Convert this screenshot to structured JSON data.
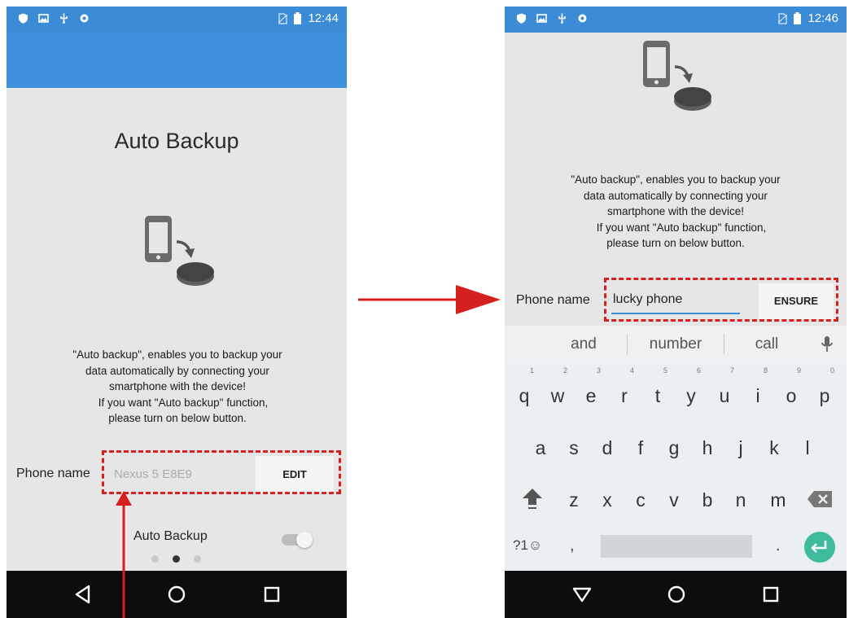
{
  "left": {
    "status": {
      "time": "12:44"
    },
    "title": "Auto Backup",
    "description": [
      "\"Auto backup\", enables you to backup your",
      "data automatically by connecting your",
      "smartphone with the device!",
      "If you want \"Auto backup\" function,",
      "please turn on below button."
    ],
    "phone_name_label": "Phone name",
    "phone_name_placeholder": "Nexus 5 E8E9",
    "edit_label": "EDIT",
    "auto_backup_label": "Auto Backup",
    "auto_backup_on": false,
    "page_indicator": {
      "count": 3,
      "active": 2
    }
  },
  "right": {
    "status": {
      "time": "12:46"
    },
    "description": [
      "\"Auto backup\", enables you to backup your",
      "data automatically by connecting your",
      "smartphone with the device!",
      "If you want \"Auto backup\" function,",
      "please turn on below button."
    ],
    "phone_name_label": "Phone name",
    "phone_name_value": "lucky phone",
    "ensure_label": "ENSURE",
    "suggestions": [
      "and",
      "number",
      "call"
    ],
    "keyboard": {
      "row1": [
        "q",
        "w",
        "e",
        "r",
        "t",
        "y",
        "u",
        "i",
        "o",
        "p"
      ],
      "row1_hints": [
        "1",
        "2",
        "3",
        "4",
        "5",
        "6",
        "7",
        "8",
        "9",
        "0"
      ],
      "row2": [
        "a",
        "s",
        "d",
        "f",
        "g",
        "h",
        "j",
        "k",
        "l"
      ],
      "row3": [
        "z",
        "x",
        "c",
        "v",
        "b",
        "n",
        "m"
      ],
      "symbols_key": "?1☺",
      "comma_key": ",",
      "period_key": "."
    }
  },
  "colors": {
    "status_bar": "#3b8bd6",
    "action_bar": "#3e8fdc",
    "highlight": "#d61f1f",
    "enter_key": "#3dbb9c",
    "nav_bar": "#0d0d0d"
  }
}
